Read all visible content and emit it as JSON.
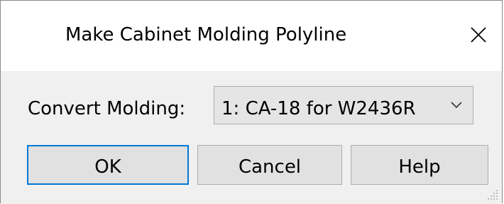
{
  "dialog": {
    "title": "Make Cabinet Molding Polyline",
    "close_icon": "close-icon"
  },
  "form": {
    "convert_label": "Convert Molding:",
    "convert_select": {
      "selected": "1:  CA-18 for W2436R",
      "chevron_icon": "chevron-down-icon"
    }
  },
  "buttons": {
    "ok_label": "OK",
    "cancel_label": "Cancel",
    "help_label": "Help"
  },
  "colors": {
    "title_bg": "#ffffff",
    "content_bg": "#f0f0f0",
    "button_bg": "#e1e1e1",
    "select_bg": "#e5e5e5",
    "focus_border": "#0078d7"
  }
}
